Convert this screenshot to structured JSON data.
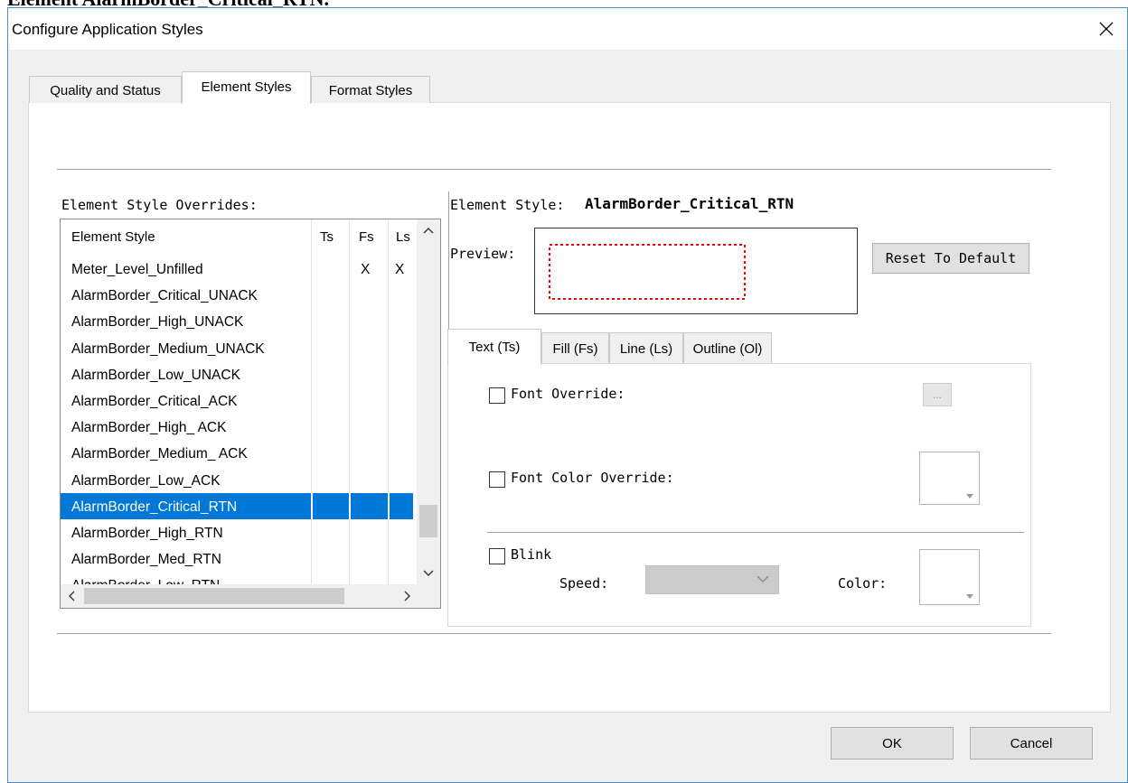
{
  "page_overflow_text": "Element AlarmBorder_Critical_RTN.",
  "dialog": {
    "title": "Configure Application Styles",
    "close_icon": "close-icon"
  },
  "outer_tabs": [
    {
      "label": "Quality and Status",
      "active": false
    },
    {
      "label": "Element Styles",
      "active": true
    },
    {
      "label": "Format Styles",
      "active": false
    }
  ],
  "overrides": {
    "label": "Element Style Overrides:",
    "columns": [
      "Element Style",
      "Ts",
      "Fs",
      "Ls"
    ],
    "rows": [
      {
        "name": "Meter_Level_Unfilled",
        "ts": "",
        "fs": "X",
        "ls": "X"
      },
      {
        "name": "AlarmBorder_Critical_UNACK",
        "ts": "",
        "fs": "",
        "ls": ""
      },
      {
        "name": "AlarmBorder_High_UNACK",
        "ts": "",
        "fs": "",
        "ls": ""
      },
      {
        "name": "AlarmBorder_Medium_UNACK",
        "ts": "",
        "fs": "",
        "ls": ""
      },
      {
        "name": "AlarmBorder_Low_UNACK",
        "ts": "",
        "fs": "",
        "ls": ""
      },
      {
        "name": "AlarmBorder_Critical_ACK",
        "ts": "",
        "fs": "",
        "ls": ""
      },
      {
        "name": "AlarmBorder_High_ ACK",
        "ts": "",
        "fs": "",
        "ls": ""
      },
      {
        "name": "AlarmBorder_Medium_ ACK",
        "ts": "",
        "fs": "",
        "ls": ""
      },
      {
        "name": "AlarmBorder_Low_ACK",
        "ts": "",
        "fs": "",
        "ls": ""
      },
      {
        "name": "AlarmBorder_Critical_RTN",
        "ts": "",
        "fs": "",
        "ls": "",
        "selected": true
      },
      {
        "name": "AlarmBorder_High_RTN",
        "ts": "",
        "fs": "",
        "ls": ""
      },
      {
        "name": "AlarmBorder_Med_RTN",
        "ts": "",
        "fs": "",
        "ls": ""
      },
      {
        "name": "AlarmBorder_Low_RTN",
        "ts": "",
        "fs": "",
        "ls": ""
      }
    ]
  },
  "detail": {
    "element_style_label": "Element Style:",
    "element_style_value": "AlarmBorder_Critical_RTN",
    "preview_label": "Preview:",
    "preview_border_color": "#ff0000",
    "reset_button": "Reset To Default"
  },
  "inner_tabs": [
    {
      "label": "Text (Ts)",
      "active": true
    },
    {
      "label": "Fill (Fs)",
      "active": false
    },
    {
      "label": "Line (Ls)",
      "active": false
    },
    {
      "label": "Outline (Ol)",
      "active": false
    }
  ],
  "text_tab": {
    "font_override_label": "Font Override:",
    "font_override_checked": false,
    "ellipsis_label": "...",
    "font_color_override_label": "Font Color Override:",
    "font_color_override_checked": false,
    "blink_label": "Blink",
    "blink_checked": false,
    "speed_label": "Speed:",
    "speed_value": "",
    "color_label": "Color:"
  },
  "buttons": {
    "ok": "OK",
    "cancel": "Cancel"
  },
  "colors": {
    "selection": "#0078d7",
    "window_border": "#4a8fd8"
  }
}
